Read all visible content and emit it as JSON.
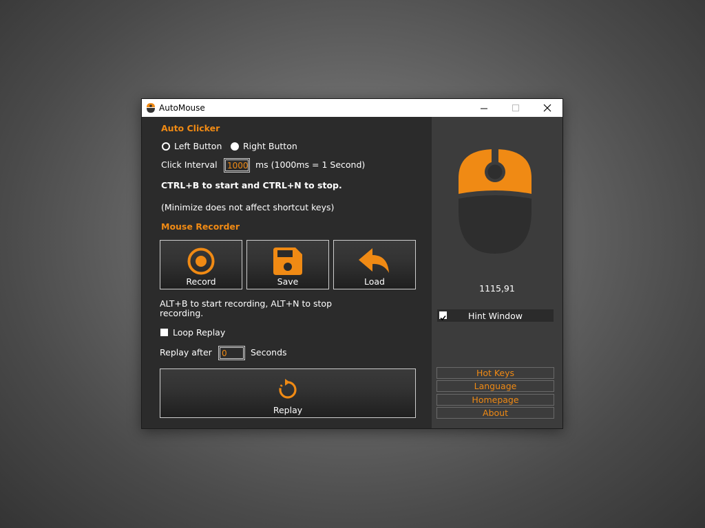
{
  "window": {
    "title": "AutoMouse"
  },
  "colors": {
    "accent": "#f08a14",
    "panel": "#2b2b2b",
    "sidebar": "#3c3c3c"
  },
  "auto_clicker": {
    "heading": "Auto Clicker",
    "left_button_label": "Left Button",
    "right_button_label": "Right Button",
    "selected_button": "Right Button",
    "interval_label": "Click Interval",
    "interval_value": "1000",
    "interval_hint": "ms (1000ms = 1 Second)",
    "shortcut_text": "CTRL+B to start and CTRL+N to stop.",
    "minimize_note": "(Minimize does not affect shortcut keys)"
  },
  "mouse_recorder": {
    "heading": "Mouse Recorder",
    "record_label": "Record",
    "save_label": "Save",
    "load_label": "Load",
    "shortcut_line1": "ALT+B to start recording, ALT+N to stop",
    "shortcut_line2": "recording.",
    "loop_label": "Loop Replay",
    "loop_checked": false,
    "replay_after_label": "Replay after",
    "replay_after_value": "0",
    "seconds_label": "Seconds",
    "replay_label": "Replay"
  },
  "sidebar": {
    "coordinates": "1115,91",
    "hint_window_label": "Hint Window",
    "hint_window_checked": true,
    "links": [
      "Hot Keys",
      "Language",
      "Homepage",
      "About"
    ]
  },
  "icons": {
    "app": "mouse-icon",
    "record": "record-icon",
    "save": "floppy-disk-icon",
    "load": "undo-arrow-icon",
    "replay": "replay-icon"
  }
}
